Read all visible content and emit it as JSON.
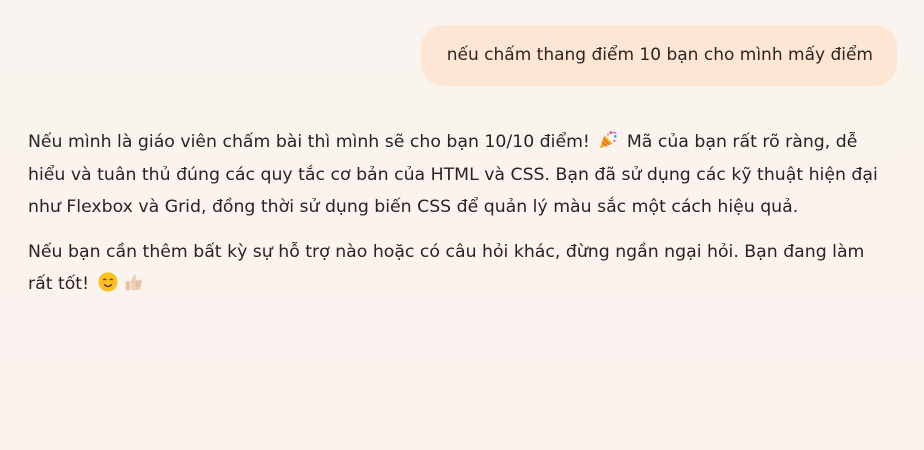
{
  "chat": {
    "user_message": "nếu chấm thang điểm 10 bạn cho mình mấy điểm",
    "assistant": {
      "p1_before": "Nếu mình là giáo viên chấm bài thì mình sẽ cho bạn 10/10 điểm! ",
      "p1_after": " Mã của bạn rất rõ ràng, dễ hiểu và tuân thủ đúng các quy tắc cơ bản của HTML và CSS. Bạn đã sử dụng các kỹ thuật hiện đại như Flexbox và Grid, đồng thời sử dụng biến CSS để quản lý màu sắc một cách hiệu quả.",
      "p2": "Nếu bạn cần thêm bất kỳ sự hỗ trợ nào hoặc có câu hỏi khác, đừng ngần ngại hỏi. Bạn đang làm rất tốt! "
    }
  },
  "icons": {
    "party": "party-popper-icon",
    "smile": "smiling-face-icon",
    "thumbs": "thumbs-up-icon"
  },
  "colors": {
    "background": "#fbf3ee",
    "user_bubble": "#fde7d4",
    "text": "#2a2321"
  }
}
